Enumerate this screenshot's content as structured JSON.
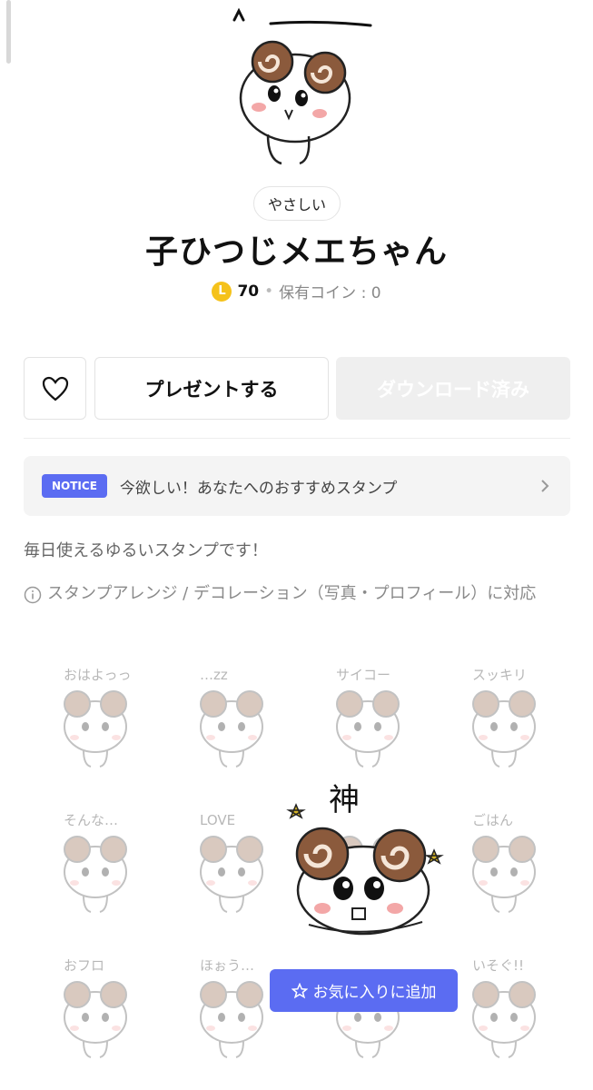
{
  "hero_image": "sticker-main",
  "tag": "やさしい",
  "title": "子ひつじメエちゃん",
  "price": {
    "coin_symbol": "L",
    "amount": "70",
    "owned_label": "保有コイン : 0"
  },
  "actions": {
    "present_label": "プレゼントする",
    "download_label": "ダウンロード済み"
  },
  "notice": {
    "badge": "NOTICE",
    "text": "今欲しい！あなたへのおすすめスタンプ"
  },
  "description": "毎日使えるゆるいスタンプです！",
  "info_text": "スタンプアレンジ / デコレーション（写真・プロフィール）に対応",
  "stickers": [
    {
      "caption": "おはよっっ"
    },
    {
      "caption": "…zz"
    },
    {
      "caption": "サイコー"
    },
    {
      "caption": "スッキリ"
    },
    {
      "caption": "そんな…"
    },
    {
      "caption": "LOVE"
    },
    {
      "caption": ""
    },
    {
      "caption": "ごはん"
    },
    {
      "caption": "おフロ"
    },
    {
      "caption": "ほぉう…"
    },
    {
      "caption": ""
    },
    {
      "caption": "いそぐ!!"
    }
  ],
  "preview_caption": "神",
  "toast_label": "お気に入りに追加",
  "colors": {
    "accent": "#5b6cf2",
    "coin": "#f5c21b",
    "horn": "#8b5a3c"
  }
}
